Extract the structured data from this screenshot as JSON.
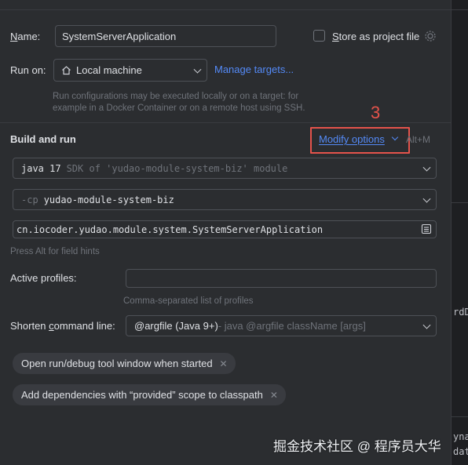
{
  "form": {
    "name_label": "Name:",
    "name_value": "SystemServerApplication",
    "store_as_project_file": "Store as project file",
    "run_on_label": "Run on:",
    "run_on_value": "Local machine",
    "manage_targets": "Manage targets...",
    "run_on_hint_1": "Run configurations may be executed locally or on a target: for",
    "run_on_hint_2": "example in a Docker Container or on a remote host using SSH."
  },
  "build_and_run": {
    "title": "Build and run",
    "annotation_number": "3",
    "modify_options": "Modify options",
    "modify_shortcut": "Alt+M",
    "jdk_main": "java 17",
    "jdk_detail": "SDK of 'yudao-module-system-biz' module",
    "cp_flag": "-cp",
    "cp_module": "yudao-module-system-biz",
    "main_class": "cn.iocoder.yudao.module.system.SystemServerApplication",
    "field_hint": "Press Alt for field hints"
  },
  "profiles": {
    "label": "Active profiles:",
    "value": "",
    "hint": "Comma-separated list of profiles"
  },
  "shorten": {
    "label": "Shorten command line:",
    "value_main": "@argfile (Java 9+)",
    "value_detail": " - java @argfile className [args]"
  },
  "chips": [
    {
      "label": "Open run/debug tool window when started"
    },
    {
      "label": "Add dependencies with “provided” scope to classpath"
    }
  ],
  "right_panel": {
    "code_1": "rdD",
    "code_2": "yna",
    "code_3": "dat"
  },
  "watermark": "掘金技术社区 @ 程序员大华",
  "icons": [
    "home-icon",
    "chevron-down-icon",
    "gear-icon",
    "browse-icon",
    "close-icon"
  ],
  "colors": {
    "accent": "#548af7",
    "annotation": "#e5534b",
    "background": "#2b2d30"
  }
}
